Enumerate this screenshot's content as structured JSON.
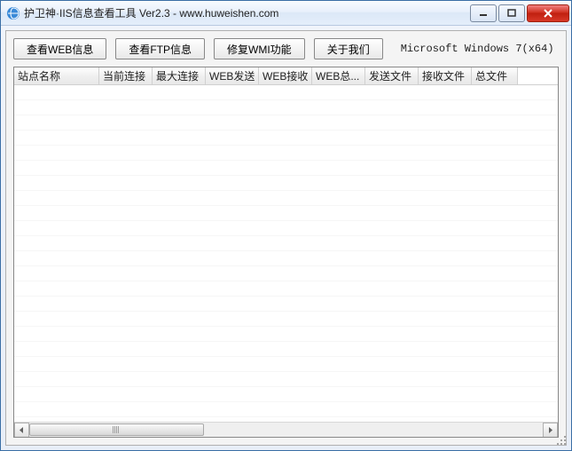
{
  "window": {
    "title": "护卫神·IIS信息查看工具 Ver2.3 - www.huweishen.com"
  },
  "toolbar": {
    "view_web": "查看WEB信息",
    "view_ftp": "查看FTP信息",
    "repair_wmi": "修复WMI功能",
    "about": "关于我们",
    "os_info": "Microsoft Windows 7(x64)"
  },
  "table": {
    "columns": [
      "站点名称",
      "当前连接",
      "最大连接",
      "WEB发送",
      "WEB接收",
      "WEB总...",
      "发送文件",
      "接收文件",
      "总文件"
    ],
    "rows": []
  }
}
